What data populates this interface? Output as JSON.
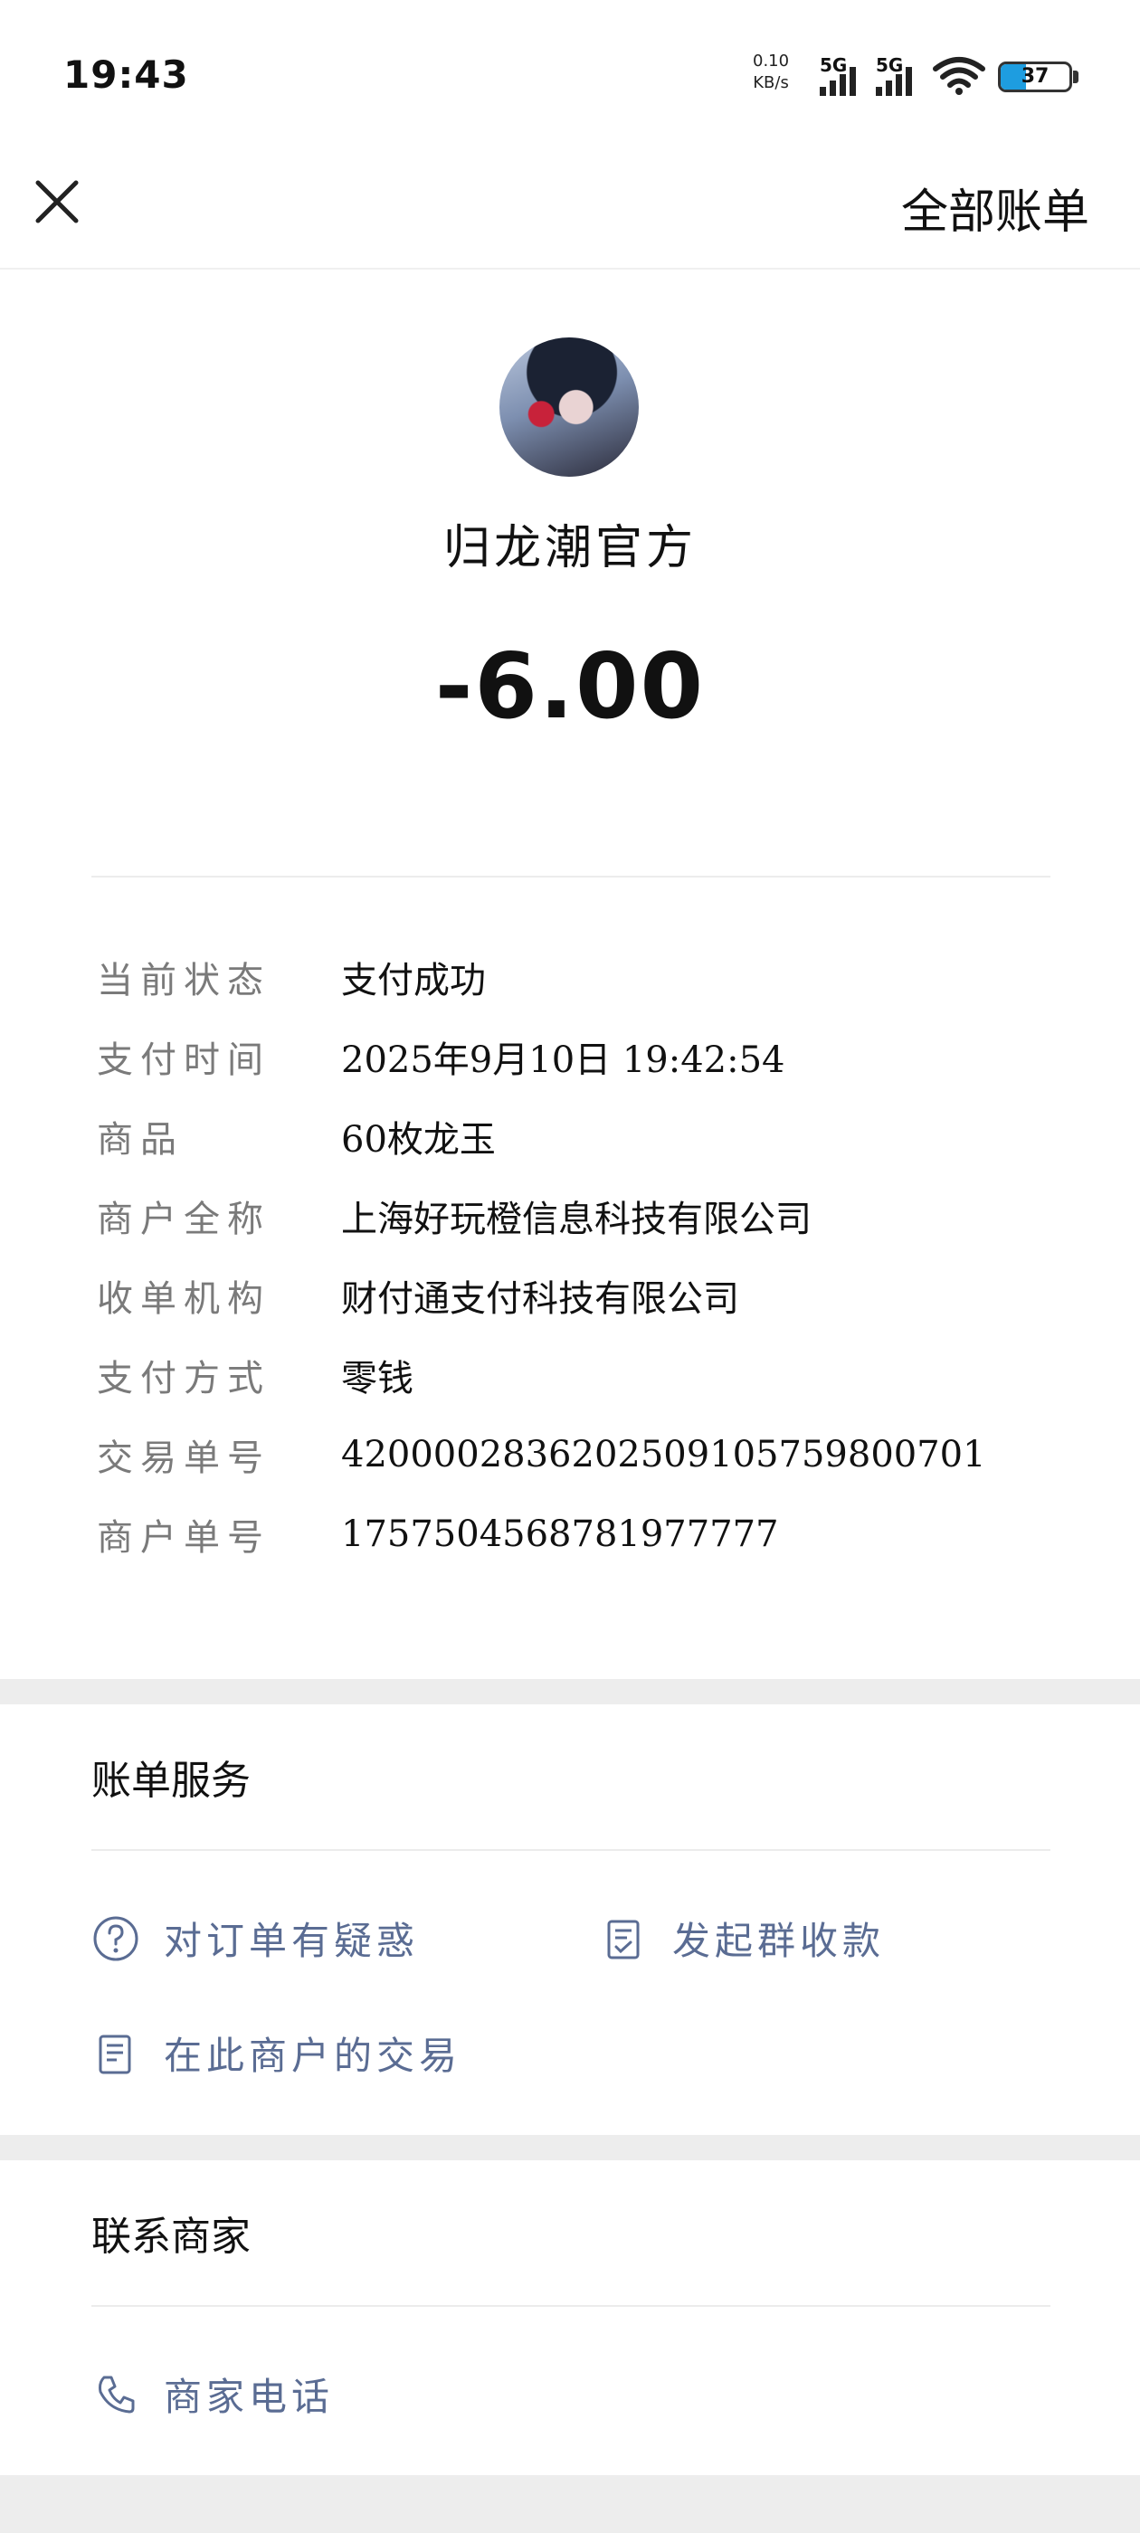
{
  "status_bar": {
    "time": "19:43",
    "net_speed_value": "0.10",
    "net_speed_unit": "KB/s",
    "sim1_label": "5G",
    "sim2_label": "5G",
    "battery_level": "37"
  },
  "nav": {
    "all_bills_label": "全部账单"
  },
  "merchant": {
    "name": "归龙潮官方",
    "amount": "-6.00"
  },
  "details": [
    {
      "label": "当前状态",
      "value": "支付成功"
    },
    {
      "label": "支付时间",
      "value": "2025年9月10日  19:42:54"
    },
    {
      "label": "商品",
      "value": "60枚龙玉"
    },
    {
      "label": "商户全称",
      "value": "上海好玩橙信息科技有限公司"
    },
    {
      "label": "收单机构",
      "value": "财付通支付科技有限公司"
    },
    {
      "label": "支付方式",
      "value": "零钱"
    },
    {
      "label": "交易单号",
      "value": "4200002836202509105759800701"
    },
    {
      "label": "商户单号",
      "value": "1757504568781977777"
    }
  ],
  "bill_service": {
    "title": "账单服务",
    "links": [
      {
        "label": "对订单有疑惑",
        "icon": "question-circle-icon"
      },
      {
        "label": "发起群收款",
        "icon": "checklist-icon"
      },
      {
        "label": "在此商户的交易",
        "icon": "document-icon"
      }
    ]
  },
  "contact": {
    "title": "联系商家",
    "phone_label": "商家电话",
    "phone_icon": "phone-icon"
  },
  "colors": {
    "accent_link": "#5a6c93",
    "battery_fill": "#1e9de0",
    "background": "#ededed"
  }
}
